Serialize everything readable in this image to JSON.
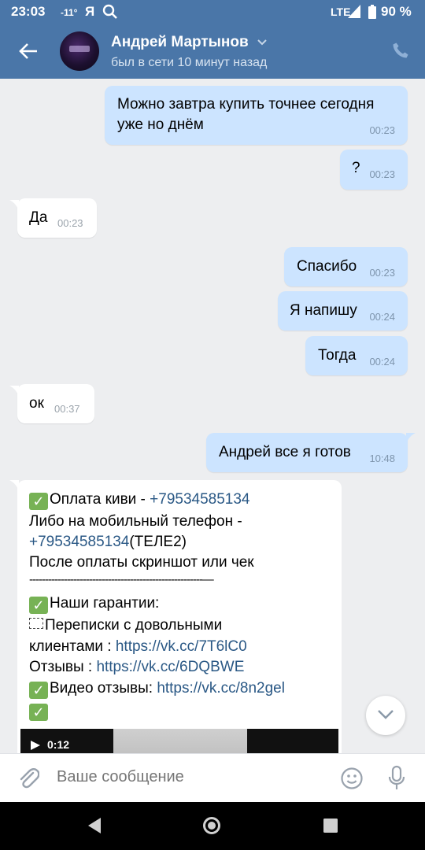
{
  "status_bar": {
    "time": "23:03",
    "temperature": "-11°",
    "ya": "Я",
    "network": "LTE",
    "battery": "90 %"
  },
  "header": {
    "name": "Андрей Мартынов",
    "last_seen": "был в сети 10 минут назад"
  },
  "messages": [
    {
      "dir": "out",
      "text": "Можно завтра купить точнее сегодня\nуже но днём",
      "time": "00:23"
    },
    {
      "dir": "out",
      "text": "?",
      "time": "00:23"
    },
    {
      "dir": "in",
      "text": "Да",
      "time": "00:23"
    },
    {
      "dir": "out",
      "text": "Спасибо",
      "time": "00:23"
    },
    {
      "dir": "out",
      "text": "Я напишу",
      "time": "00:24"
    },
    {
      "dir": "out",
      "text": "Тогда",
      "time": "00:24"
    },
    {
      "dir": "in",
      "text": "ок",
      "time": "00:37"
    },
    {
      "dir": "out",
      "text": "Андрей все я готов",
      "time": "10:48"
    }
  ],
  "long_message": {
    "l1_text": "Оплата киви - ",
    "l1_link": "+79534585134",
    "l2_text": "Либо на мобильный телефон -",
    "l3_link": "+79534585134",
    "l3_text": "(ТЕЛЕ2)",
    "l4_text": "После оплаты скриншот или чек",
    "l5_text": "-------------------------------------------------------—",
    "l6_text": "Наши гарантии:",
    "l7_text": "Переписки с довольными",
    "l8_text": "клиентами : ",
    "l8_link": "https://vk.cc/7T6lC0",
    "l9_text": "Отзывы : ",
    "l9_link": "https://vk.cc/6DQBWE",
    "l10_text": "Видео отзывы: ",
    "l10_link": "https://vk.cc/8n2gel",
    "video_duration": "0:12"
  },
  "composer": {
    "placeholder": "Ваше сообщение"
  },
  "colors": {
    "header": "#4a76a8",
    "outgoing_bubble": "#cce4ff",
    "incoming_bubble": "#ffffff",
    "link": "#2a5885",
    "background": "#edeef0"
  }
}
